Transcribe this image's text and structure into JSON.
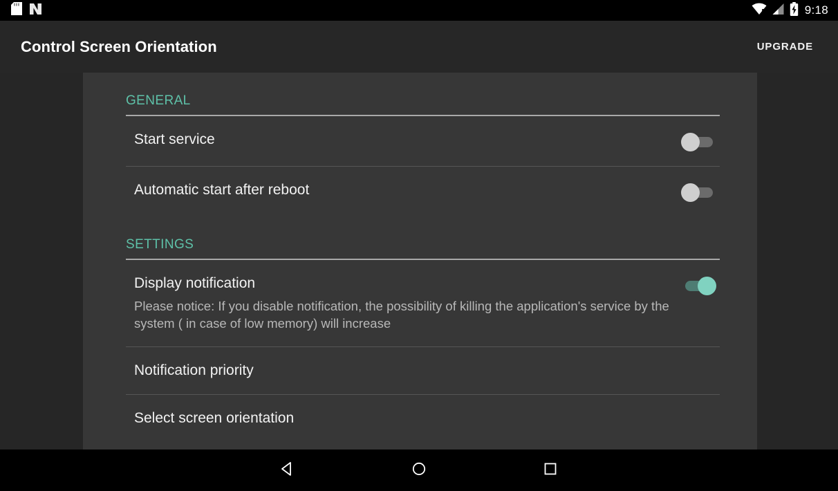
{
  "status_bar": {
    "left_icons": [
      "sd-card-icon",
      "android-n-icon"
    ],
    "right_icons": [
      "wifi-alert-icon",
      "cellular-signal-icon",
      "battery-charging-icon"
    ],
    "time": "9:18"
  },
  "app_bar": {
    "title": "Control Screen Orientation",
    "action_label": "UPGRADE"
  },
  "colors": {
    "accent": "#5ec1a8",
    "switch_on_thumb": "#80d2c0",
    "switch_on_track": "#4e7c73",
    "switch_off_thumb": "#cfcfcf",
    "switch_off_track": "#6b6b6b",
    "panel_background": "#373737",
    "window_background": "#262626",
    "app_bar_background": "#272727"
  },
  "sections": [
    {
      "header": "GENERAL",
      "items": [
        {
          "title": "Start service",
          "summary": "",
          "control": "switch",
          "checked": false,
          "name": "start-service"
        },
        {
          "title": "Automatic start after reboot",
          "summary": "",
          "control": "switch",
          "checked": false,
          "name": "automatic-start-after-reboot"
        }
      ]
    },
    {
      "header": "SETTINGS",
      "items": [
        {
          "title": "Display notification",
          "summary": "Please notice: If you disable notification, the possibility of killing the application's service by the system ( in case of low memory) will increase",
          "control": "switch",
          "checked": true,
          "name": "display-notification"
        },
        {
          "title": "Notification priority",
          "summary": "",
          "control": "none",
          "checked": false,
          "name": "notification-priority"
        },
        {
          "title": "Select screen orientation",
          "summary": "",
          "control": "none",
          "checked": false,
          "name": "select-screen-orientation"
        }
      ]
    }
  ],
  "nav_bar": {
    "buttons": [
      {
        "name": "back-icon",
        "label": "Back"
      },
      {
        "name": "home-icon",
        "label": "Home"
      },
      {
        "name": "recents-icon",
        "label": "Recents"
      }
    ]
  }
}
